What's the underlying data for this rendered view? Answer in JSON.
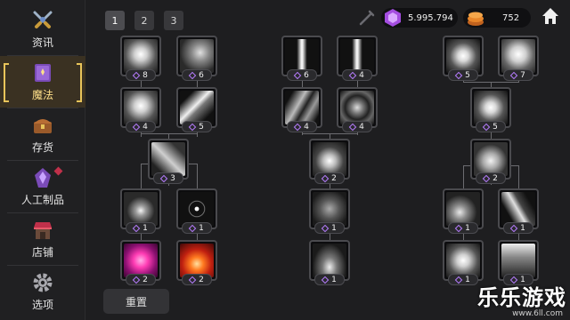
{
  "sidebar": {
    "items": [
      {
        "label": "资讯",
        "icon": "swords-icon"
      },
      {
        "label": "魔法",
        "icon": "spellbook-icon"
      },
      {
        "label": "存货",
        "icon": "chest-icon"
      },
      {
        "label": "人工制品",
        "icon": "crystal-icon"
      },
      {
        "label": "店铺",
        "icon": "shop-icon"
      },
      {
        "label": "选项",
        "icon": "gear-icon"
      }
    ],
    "active_index": 1
  },
  "tabs": [
    "1",
    "2",
    "3"
  ],
  "active_tab": "1",
  "currency": {
    "gems": "5.995.794",
    "coins": "752"
  },
  "reset_label": "重置",
  "tree": {
    "nodes": [
      {
        "id": "n1",
        "level": "8",
        "theme": "light"
      },
      {
        "id": "n2",
        "level": "6",
        "theme": "wind"
      },
      {
        "id": "n3",
        "level": "4",
        "theme": "light"
      },
      {
        "id": "n4",
        "level": "5",
        "theme": "slash"
      },
      {
        "id": "n5",
        "level": "3",
        "theme": "blade"
      },
      {
        "id": "n6",
        "level": "1",
        "theme": "sparkle"
      },
      {
        "id": "n7",
        "level": "1",
        "theme": "target"
      },
      {
        "id": "n8",
        "level": "2",
        "theme": "heart"
      },
      {
        "id": "n9",
        "level": "2",
        "theme": "fire"
      },
      {
        "id": "m1",
        "level": "6",
        "theme": "sword"
      },
      {
        "id": "m2",
        "level": "4",
        "theme": "sword"
      },
      {
        "id": "m3",
        "level": "4",
        "theme": "claw"
      },
      {
        "id": "m4",
        "level": "4",
        "theme": "vortex"
      },
      {
        "id": "m5",
        "level": "2",
        "theme": "burst"
      },
      {
        "id": "m6",
        "level": "1",
        "theme": "shield"
      },
      {
        "id": "m7",
        "level": "1",
        "theme": "figure"
      },
      {
        "id": "r1",
        "level": "5",
        "theme": "orb"
      },
      {
        "id": "r2",
        "level": "7",
        "theme": "angel"
      },
      {
        "id": "r3",
        "level": "5",
        "theme": "orb"
      },
      {
        "id": "r4",
        "level": "2",
        "theme": "lotus"
      },
      {
        "id": "r5",
        "level": "1",
        "theme": "vine"
      },
      {
        "id": "r6",
        "level": "1",
        "theme": "bolt"
      },
      {
        "id": "r7",
        "level": "1",
        "theme": "heart-white"
      },
      {
        "id": "r8",
        "level": "1",
        "theme": "gate"
      }
    ]
  },
  "watermark": {
    "main": "乐乐游戏",
    "sub": "www.6ll.com"
  },
  "colors": {
    "accent": "#e8c45a",
    "gem": "#b77dff",
    "coin": "#e8862a"
  }
}
